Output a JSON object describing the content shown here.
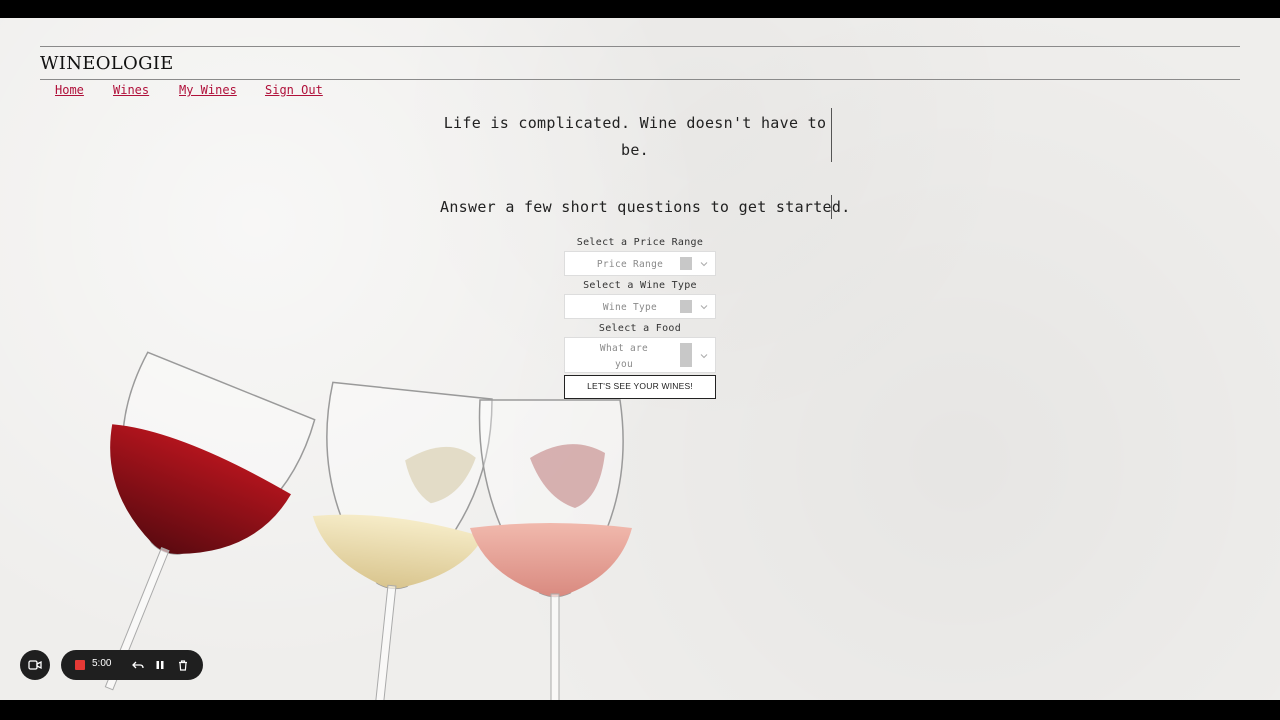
{
  "brand": "WINEOLOGIE",
  "nav": [
    {
      "label": "Home"
    },
    {
      "label": "Wines"
    },
    {
      "label": "My Wines"
    },
    {
      "label": "Sign Out"
    }
  ],
  "hero": {
    "tagline": "Life is complicated. Wine doesn't have to be.",
    "subline": "Answer a few short questions to get started."
  },
  "form": {
    "price": {
      "label": "Select a Price Range",
      "value": "Price Range"
    },
    "type": {
      "label": "Select a Wine Type",
      "value": "Wine Type"
    },
    "food": {
      "label": "Select a Food",
      "value": "What are you serving?"
    },
    "submit": "LET'S SEE YOUR WINES!"
  },
  "recorder": {
    "time": "5:00"
  },
  "colors": {
    "link": "#b0103a",
    "background": "#efeeec",
    "record": "#e53935"
  }
}
